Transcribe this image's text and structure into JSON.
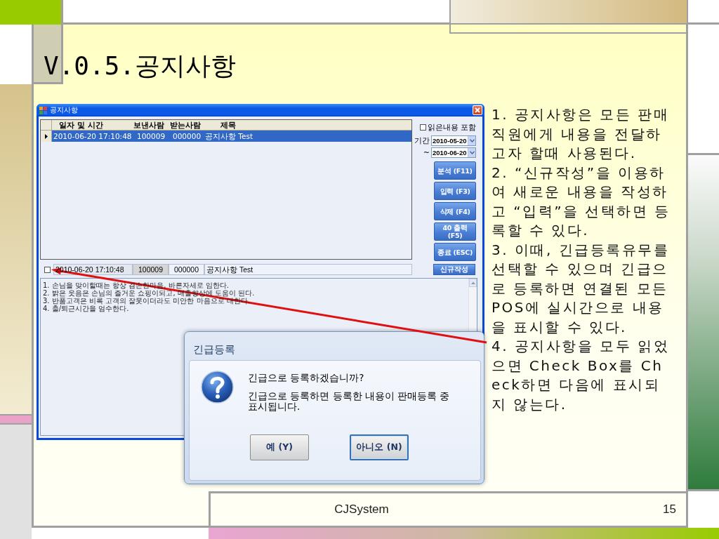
{
  "slide": {
    "title": "V.0.5.공지사항",
    "footer": "CJSystem",
    "page_number": "15"
  },
  "window": {
    "title": "공지사항",
    "table": {
      "columns": [
        "일자 및 시간",
        "보낸사람",
        "받는사람",
        "제목"
      ],
      "rows": [
        {
          "selected": true,
          "cells": [
            "2010-06-20 17:10:48",
            "100009",
            "000000",
            "공지사항 Test"
          ]
        }
      ]
    },
    "filters": {
      "include_read": {
        "label": "읽은내용 포함",
        "checked": false
      },
      "period_label": "기간",
      "date_from": "2010-05-20",
      "range_separator": "~",
      "date_to": "2010-06-20"
    },
    "buttons": [
      "분석 (F11)",
      "입력 (F3)",
      "삭제 (F4)",
      "40 출력\n(F5)",
      "종료 (ESC)"
    ],
    "editor": {
      "read_checked": false,
      "datetime": "2010-06-20 17:10:48",
      "sender": "100009",
      "receiver": "000000",
      "subject": "공지사항 Test",
      "new_button": "신규작성",
      "body_lines": [
        "1. 손님을 맞이할때는 항상 겸손한마음, 바른자세로 임한다.",
        "2. 밝은 웃음은 손님의 즐거운 쇼핑이되고, 매출향상에 도움이 된다.",
        "3. 반품고객은 비록 고객의 잘못이더라도 미안한 마음으로 대한다.",
        "4. 출/퇴근시간을 엄수한다."
      ]
    }
  },
  "dialog": {
    "title": "긴급등록",
    "question": "긴급으로 등록하겠습니까?",
    "message": "긴급으로 등록하면 등록한 내용이 판매등록 중 표시됩니다.",
    "buttons": [
      {
        "label": "예 (Y)",
        "focused": false
      },
      {
        "label": "아니오 (N)",
        "focused": true
      }
    ]
  },
  "notes": [
    "1. 공지사항은 모든 판매직원에게 내용을 전달하고자 할때 사용된다.",
    "2. “신규작성”을 이용하여 새로운 내용을 작성하고 “입력”을 선택하면 등록할 수 있다.",
    "3. 이때, 긴급등록유무를 선택할 수 있으며 긴급으로 등록하면 연결된 모든 POS에 실시간으로 내용을 표시할 수 있다.",
    "4. 공지사항을 모두 읽었으면 Check Box를 Check하면 다음에 표시되지 않는다."
  ]
}
